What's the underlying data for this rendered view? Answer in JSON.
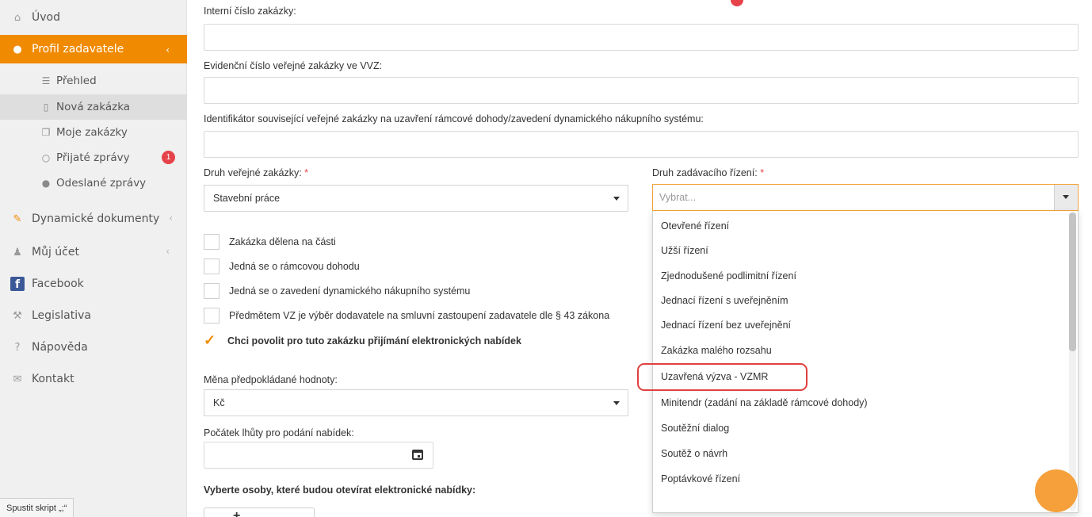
{
  "sidebar": {
    "items": [
      {
        "label": "Úvod",
        "icon": "home-icon"
      },
      {
        "label": "Profil zadavatele",
        "icon": "profile-icon",
        "chevron": "‹"
      },
      {
        "label": "Dynamické dokumenty",
        "icon": "edit-icon",
        "chevron": "‹"
      },
      {
        "label": "Můj účet",
        "icon": "user-icon",
        "chevron": "‹"
      },
      {
        "label": "Facebook",
        "icon": "facebook-icon"
      },
      {
        "label": "Legislativa",
        "icon": "gavel-icon"
      },
      {
        "label": "Nápověda",
        "icon": "help-icon"
      },
      {
        "label": "Kontakt",
        "icon": "mail-icon"
      }
    ],
    "subitems": [
      {
        "label": "Přehled",
        "icon": "list-icon"
      },
      {
        "label": "Nová zakázka",
        "icon": "file-icon"
      },
      {
        "label": "Moje zakázky",
        "icon": "copy-icon"
      },
      {
        "label": "Přijaté zprávy",
        "icon": "chat-outline-icon",
        "badge": "1"
      },
      {
        "label": "Odeslané zprávy",
        "icon": "chat-filled-icon"
      }
    ],
    "active_color": "#f08a00"
  },
  "status_bar": {
    "text": "Spustit skript „;“"
  },
  "form": {
    "internal_number_label": "Interní číslo zakázky:",
    "evidence_number_label": "Evidenční číslo veřejné zakázky ve VVZ:",
    "identifier_label": "Identifikátor související veřejné zakázky na uzavření rámcové dohody/zavedení dynamického nákupního systému:",
    "contract_type_label": "Druh veřejné zakázky: ",
    "contract_type_value": "Stavební práce",
    "procedure_type_label": "Druh zadávacího řízení: ",
    "procedure_placeholder": "Vybrat...",
    "required_mark": "*",
    "checkboxes": [
      {
        "label": "Zakázka dělena na části",
        "checked": false
      },
      {
        "label": "Jedná se o rámcovou dohodu",
        "checked": false
      },
      {
        "label": "Jedná se o zavedení dynamického nákupního systému",
        "checked": false
      },
      {
        "label": "Předmětem VZ je výběr dodavatele na smluvní zastoupení zadavatele dle § 43 zákona",
        "checked": false
      },
      {
        "label": "Chci povolit pro tuto zakázku přijímání elektronických nabídek",
        "checked": true
      }
    ],
    "currency_label": "Měna předpokládané hodnoty:",
    "currency_value": "Kč",
    "deadline_start_label": "Počátek lhůty pro podání nabídek:",
    "openers_label": "Vyberte osoby, které budou otevírat elektronické nabídky:",
    "add_button_symbol": "+"
  },
  "dropdown": {
    "options": [
      "Otevřené řízení",
      "Užší řízení",
      "Zjednodušené podlimitní řízení",
      "Jednací řízení s uveřejněním",
      "Jednací řízení bez uveřejnění",
      "Zakázka malého rozsahu",
      "Uzavřená výzva - VZMR",
      "Minitendr (zadání na základě rámcové dohody)",
      "Soutěžní dialog",
      "Soutěž o návrh",
      "Poptávkové řízení"
    ],
    "highlighted_option": "Uzavřená výzva - VZMR",
    "highlight_color": "#e0413e"
  }
}
